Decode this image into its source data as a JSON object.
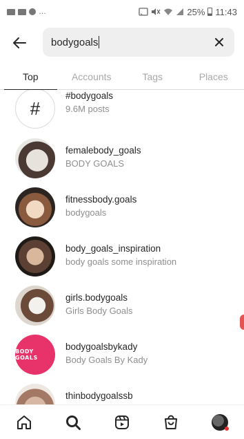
{
  "status_bar": {
    "battery": "25%",
    "time": "11:43"
  },
  "search": {
    "query": "bodygoals"
  },
  "tabs": [
    {
      "label": "Top",
      "active": true
    },
    {
      "label": "Accounts",
      "active": false
    },
    {
      "label": "Tags",
      "active": false
    },
    {
      "label": "Places",
      "active": false
    }
  ],
  "results": [
    {
      "title": "#bodygoals",
      "subtitle": "9.6M posts",
      "type": "hashtag"
    },
    {
      "title": "femalebody_goals",
      "subtitle": "BODY GOALS",
      "type": "account"
    },
    {
      "title": "fitnessbody.goals",
      "subtitle": "bodygoals",
      "type": "account"
    },
    {
      "title": "body_goals_inspiration",
      "subtitle": "body goals some inspiration",
      "type": "account"
    },
    {
      "title": "girls.bodygoals",
      "subtitle": "Girls Body Goals",
      "type": "account"
    },
    {
      "title": "bodygoalsbykady",
      "subtitle": "Body Goals By Kady",
      "type": "account",
      "avatar_text": "BODY GOALS"
    },
    {
      "title": "thinbodygoalssb",
      "subtitle": "",
      "type": "account"
    }
  ],
  "icons": {
    "back": "arrow-left-icon",
    "clear": "close-icon",
    "hashtag": "#",
    "nav": [
      "home-icon",
      "search-icon",
      "reels-icon",
      "shop-icon",
      "profile-avatar"
    ]
  },
  "colors": {
    "text": "#262626",
    "muted": "#8e8e8e",
    "search_bg": "#efefef",
    "kady_avatar": "#e8336a"
  }
}
